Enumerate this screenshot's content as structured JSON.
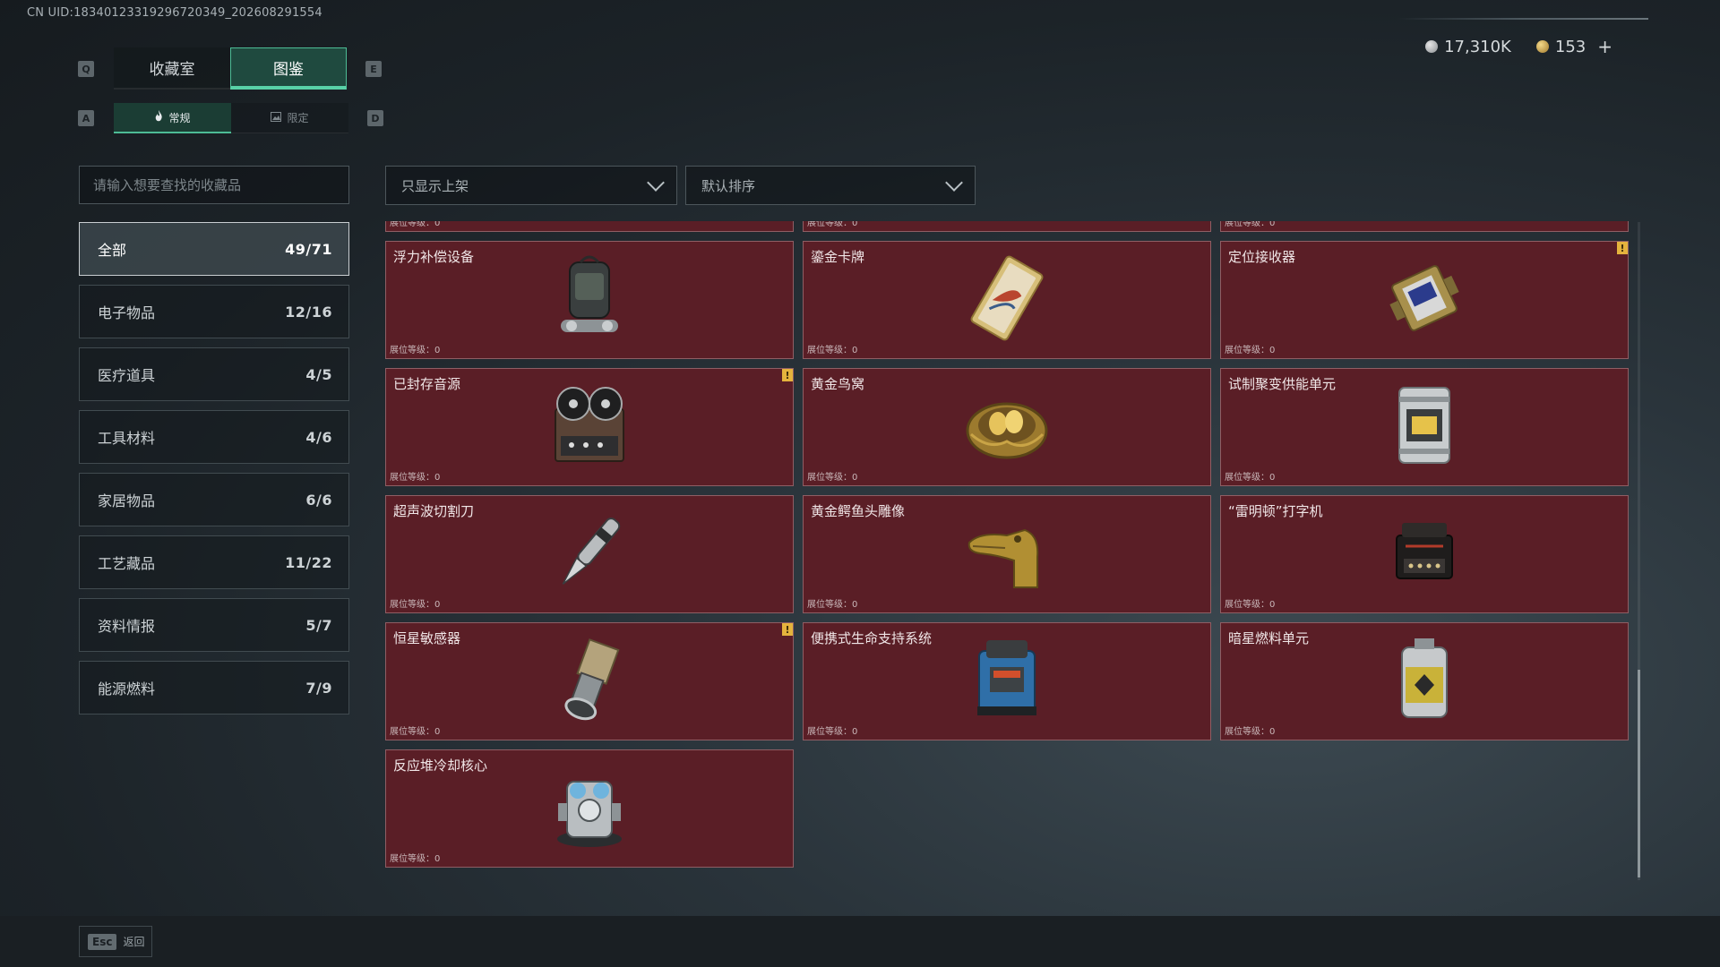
{
  "uid_text": "CN UID:18340123319296720349_202608291554",
  "top_tabs": [
    {
      "label": "收藏室",
      "active": false
    },
    {
      "label": "图鉴",
      "active": true
    }
  ],
  "top_tab_keys": {
    "left": "Q",
    "right": "E"
  },
  "sub_tabs": [
    {
      "label": "常规",
      "active": true,
      "icon": "flame-icon"
    },
    {
      "label": "限定",
      "active": false,
      "icon": "image-icon"
    }
  ],
  "sub_tab_keys": {
    "left": "A",
    "right": "D"
  },
  "currency": [
    {
      "value": "17,310K",
      "icon": "silver-coin-icon"
    },
    {
      "value": "153",
      "icon": "gold-coin-icon"
    }
  ],
  "currency_plus": "+",
  "search": {
    "placeholder": "请输入想要查找的收藏品"
  },
  "filters": {
    "shelf": "只显示上架",
    "sort": "默认排序"
  },
  "categories": [
    {
      "label": "全部",
      "count": "49/71",
      "active": true
    },
    {
      "label": "电子物品",
      "count": "12/16",
      "active": false
    },
    {
      "label": "医疗道具",
      "count": "4/5",
      "active": false
    },
    {
      "label": "工具材料",
      "count": "4/6",
      "active": false
    },
    {
      "label": "家居物品",
      "count": "6/6",
      "active": false
    },
    {
      "label": "工艺藏品",
      "count": "11/22",
      "active": false
    },
    {
      "label": "资料情报",
      "count": "5/7",
      "active": false
    },
    {
      "label": "能源燃料",
      "count": "7/9",
      "active": false
    }
  ],
  "level_label": "展位等级：0",
  "items": [
    {
      "name": "",
      "icon": "",
      "warn": false
    },
    {
      "name": "",
      "icon": "",
      "warn": false
    },
    {
      "name": "",
      "icon": "",
      "warn": false
    },
    {
      "name": "浮力补偿设备",
      "icon": "buoyancy-device-icon",
      "warn": false
    },
    {
      "name": "鎏金卡牌",
      "icon": "gold-card-icon",
      "warn": false
    },
    {
      "name": "定位接收器",
      "icon": "locator-receiver-icon",
      "warn": true
    },
    {
      "name": "已封存音源",
      "icon": "tape-recorder-icon",
      "warn": true
    },
    {
      "name": "黄金鸟窝",
      "icon": "golden-nest-icon",
      "warn": false
    },
    {
      "name": "试制聚变供能单元",
      "icon": "fusion-unit-icon",
      "warn": false
    },
    {
      "name": "超声波切割刀",
      "icon": "ultrasonic-cutter-icon",
      "warn": false
    },
    {
      "name": "黄金鳄鱼头雕像",
      "icon": "gold-crocodile-icon",
      "warn": false
    },
    {
      "name": "“雷明顿”打字机",
      "icon": "typewriter-icon",
      "warn": false
    },
    {
      "name": "恒星敏感器",
      "icon": "star-sensor-icon",
      "warn": true
    },
    {
      "name": "便携式生命支持系统",
      "icon": "life-support-icon",
      "warn": false
    },
    {
      "name": "暗星燃料单元",
      "icon": "fuel-canister-icon",
      "warn": false
    },
    {
      "name": "反应堆冷却核心",
      "icon": "reactor-core-icon",
      "warn": false
    }
  ],
  "warn_symbol": "!",
  "back": {
    "key": "Esc",
    "label": "返回"
  }
}
